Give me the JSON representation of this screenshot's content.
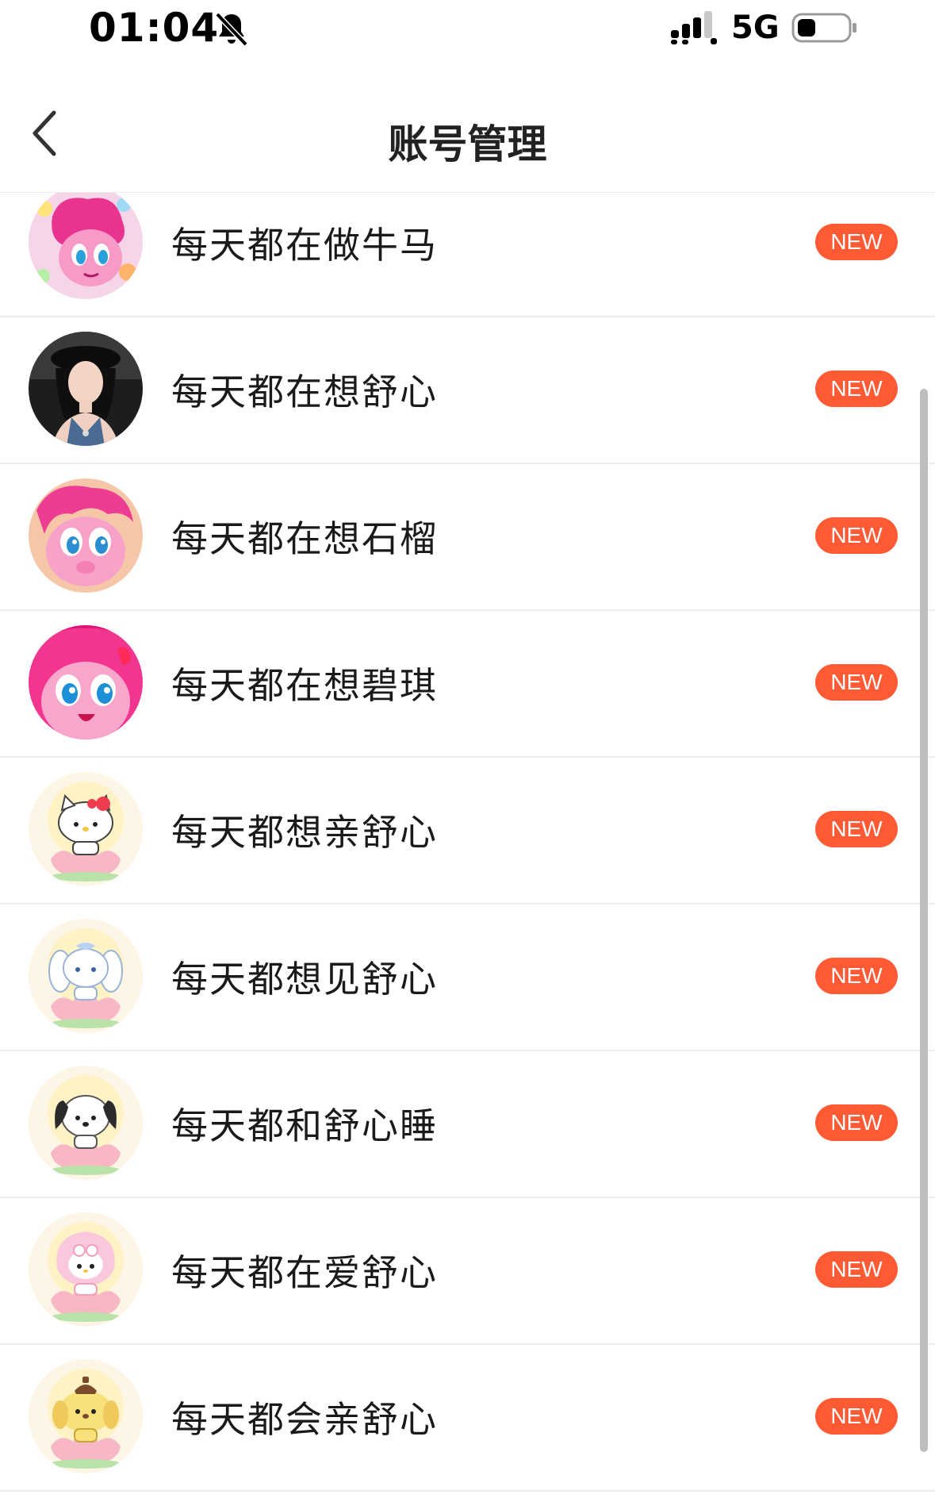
{
  "status_bar": {
    "time": "01:04",
    "network": "5G"
  },
  "header": {
    "title": "账号管理"
  },
  "accounts": [
    {
      "name": "每天都在做牛马",
      "badge": "NEW",
      "avatar": "pinkie-pie-avatar"
    },
    {
      "name": "每天都在想舒心",
      "badge": "NEW",
      "avatar": "girl-photo-avatar"
    },
    {
      "name": "每天都在想石榴",
      "badge": "NEW",
      "avatar": "pinkie-pie-avatar"
    },
    {
      "name": "每天都在想碧琪",
      "badge": "NEW",
      "avatar": "pinkie-pie-avatar"
    },
    {
      "name": "每天都想亲舒心",
      "badge": "NEW",
      "avatar": "hello-kitty-avatar"
    },
    {
      "name": "每天都想见舒心",
      "badge": "NEW",
      "avatar": "cinnamoroll-avatar"
    },
    {
      "name": "每天都和舒心睡",
      "badge": "NEW",
      "avatar": "pochacco-avatar"
    },
    {
      "name": "每天都在爱舒心",
      "badge": "NEW",
      "avatar": "my-melody-avatar"
    },
    {
      "name": "每天都会亲舒心",
      "badge": "NEW",
      "avatar": "pompompurin-avatar"
    }
  ],
  "colors": {
    "badge": "#ff5a33",
    "divider": "#eeeeee",
    "text": "#1a1a1a"
  }
}
